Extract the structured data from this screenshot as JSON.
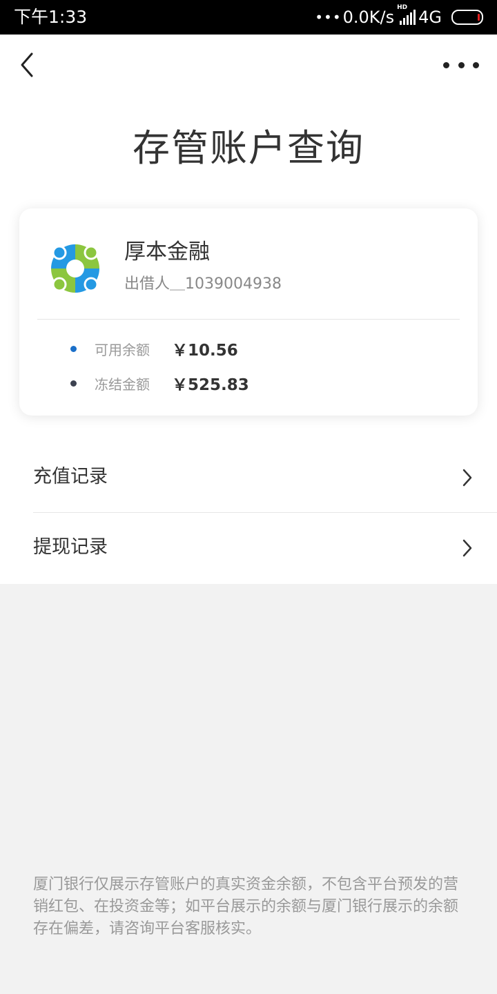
{
  "status_bar": {
    "time": "下午1:33",
    "net_speed": "0.0K/s",
    "hd_label": "HD",
    "network": "4G"
  },
  "header": {
    "title": "存管账户查询"
  },
  "card": {
    "platform_name": "厚本金融",
    "account_id": "出借人＿1039004938",
    "balances": [
      {
        "label": "可用余额",
        "value": "￥10.56",
        "dot_color": "#1a6fc9"
      },
      {
        "label": "冻结金额",
        "value": "￥525.83",
        "dot_color": "#3c4250"
      }
    ]
  },
  "menu": [
    {
      "label": "充值记录"
    },
    {
      "label": "提现记录"
    }
  ],
  "disclaimer": "厦门银行仅展示存管账户的真实资金余额，不包含平台预发的营销红包、在投资金等；如平台展示的余额与厦门银行展示的余额存在偏差，请咨询平台客服核实。",
  "colors": {
    "logo_blue": "#2499e3",
    "logo_green": "#8cc63f"
  }
}
